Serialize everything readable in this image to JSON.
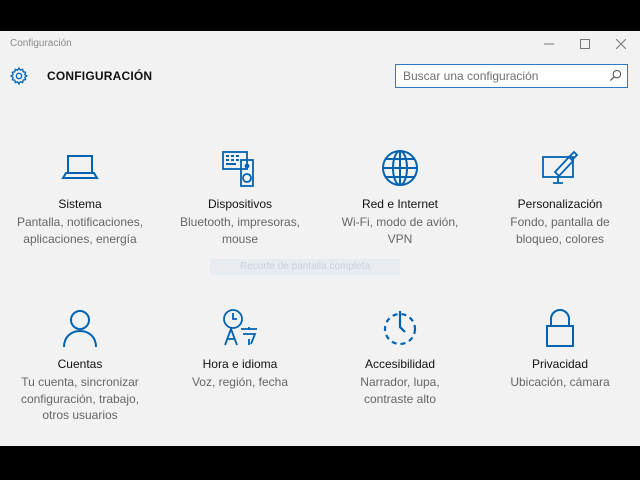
{
  "window": {
    "title": "Configuración"
  },
  "header": {
    "title": "CONFIGURACIÓN"
  },
  "search": {
    "placeholder": "Buscar una configuración"
  },
  "ghost_tooltip": "Recorte de pantalla completa",
  "accent_color": "#0063b1",
  "tiles": [
    {
      "icon": "laptop-icon",
      "label": "Sistema",
      "desc": [
        "Pantalla, notificaciones,",
        "aplicaciones, energía"
      ]
    },
    {
      "icon": "devices-icon",
      "label": "Dispositivos",
      "desc": [
        "Bluetooth, impresoras,",
        "mouse"
      ]
    },
    {
      "icon": "globe-icon",
      "label": "Red e Internet",
      "desc": [
        "Wi-Fi, modo de avión,",
        "VPN"
      ]
    },
    {
      "icon": "paint-icon",
      "label": "Personalización",
      "desc": [
        "Fondo, pantalla de",
        "bloqueo, colores"
      ]
    },
    {
      "icon": "person-icon",
      "label": "Cuentas",
      "desc": [
        "Tu cuenta, sincronizar",
        "configuración, trabajo,",
        "otros usuarios"
      ]
    },
    {
      "icon": "language-icon",
      "label": "Hora e idioma",
      "desc": [
        "Voz, región, fecha"
      ]
    },
    {
      "icon": "accessibility-icon",
      "label": "Accesibilidad",
      "desc": [
        "Narrador, lupa,",
        "contraste alto"
      ]
    },
    {
      "icon": "lock-icon",
      "label": "Privacidad",
      "desc": [
        "Ubicación, cámara"
      ]
    }
  ]
}
